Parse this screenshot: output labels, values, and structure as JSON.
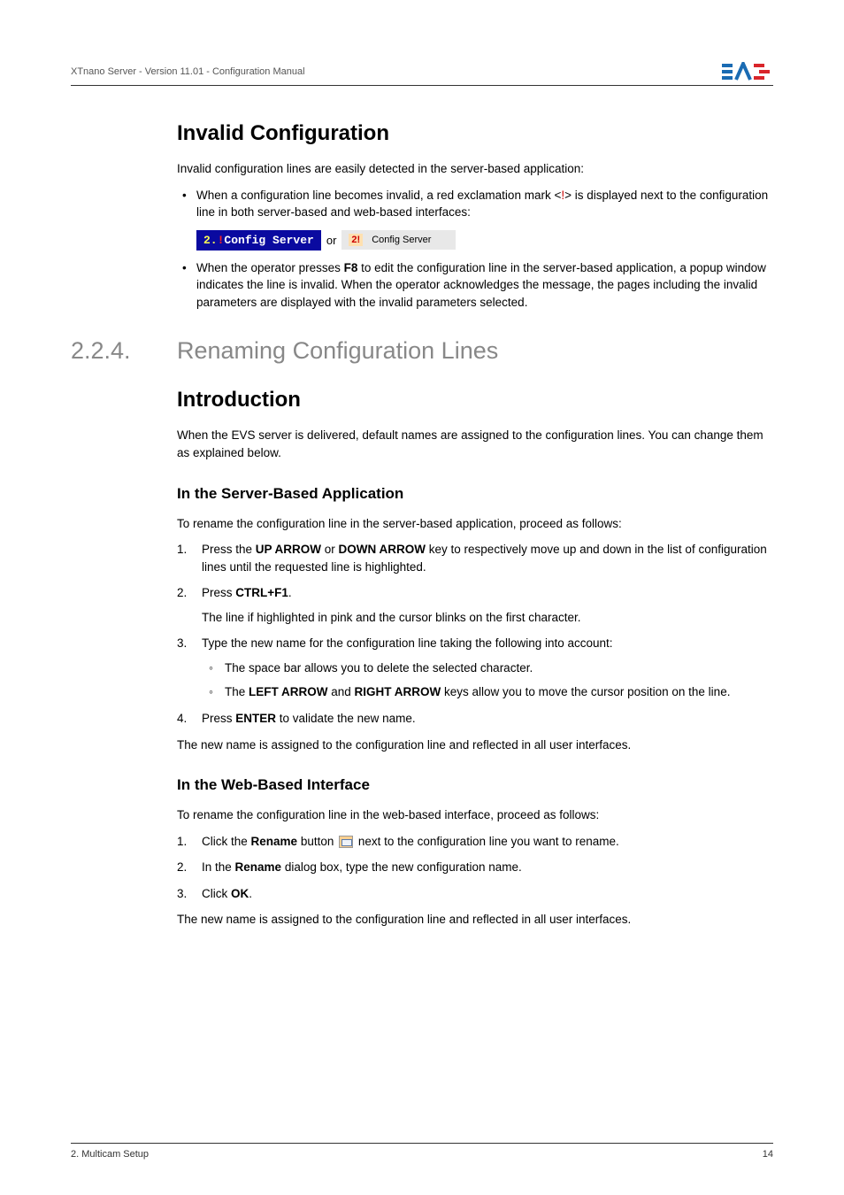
{
  "header": {
    "left": "XTnano Server - Version 11.01 - Configuration Manual"
  },
  "sec1": {
    "title": "Invalid Configuration",
    "p1": "Invalid configuration lines are easily detected in the server-based application:",
    "b1a": "When a configuration line becomes invalid, a red exclamation mark <",
    "b1b": "!",
    "b1c": "> is displayed next to the configuration line in both server-based and web-based interfaces:",
    "badge_num": "2.",
    "badge_excl": "!",
    "badge_text": "Config Server",
    "or": "or",
    "web_excl": "2!",
    "web_text": "Config Server",
    "b2a": "When the operator presses ",
    "b2b": "F8",
    "b2c": " to edit the configuration line in the server-based application, a popup window indicates the line is invalid. When the operator acknowledges the message, the pages including the invalid parameters are displayed with the invalid parameters selected."
  },
  "sec2": {
    "num": "2.2.4.",
    "title": "Renaming Configuration Lines"
  },
  "intro": {
    "title": "Introduction",
    "p1": "When the EVS server is delivered, default names are assigned to the configuration lines. You can change them as explained below."
  },
  "server": {
    "title": "In the Server-Based Application",
    "p1": "To rename the configuration line in the server-based application, proceed as follows:",
    "s1a": "Press the ",
    "s1b": "UP ARROW",
    "s1c": " or ",
    "s1d": "DOWN ARROW",
    "s1e": " key to respectively move up and down in the list of configuration lines until the requested line is highlighted.",
    "s2a": "Press ",
    "s2b": "CTRL+F1",
    "s2c": ".",
    "s2sub": "The line if highlighted in pink and the cursor blinks on the first character.",
    "s3": "Type the new name for the configuration line taking the following into account:",
    "s3a": "The space bar allows you to delete the selected character.",
    "s3ba": "The ",
    "s3bb": "LEFT ARROW",
    "s3bc": " and ",
    "s3bd": "RIGHT ARROW",
    "s3be": " keys allow you to move the cursor position on the line.",
    "s4a": "Press ",
    "s4b": "ENTER",
    "s4c": " to validate the new name.",
    "p2": "The new name is assigned to the configuration line and reflected in all user interfaces."
  },
  "web": {
    "title": "In the Web-Based Interface",
    "p1": "To rename the configuration line in the web-based interface, proceed as follows:",
    "s1a": "Click the ",
    "s1b": "Rename",
    "s1c": " button ",
    "s1d": " next to the configuration line you want to rename.",
    "s2a": "In the ",
    "s2b": "Rename",
    "s2c": " dialog box, type the new configuration name.",
    "s3a": "Click ",
    "s3b": "OK",
    "s3c": ".",
    "p2": "The new name is assigned to the configuration line and reflected in all user interfaces."
  },
  "footer": {
    "left": "2. Multicam Setup",
    "right": "14"
  },
  "nums": {
    "n1": "1.",
    "n2": "2.",
    "n3": "3.",
    "n4": "4."
  }
}
